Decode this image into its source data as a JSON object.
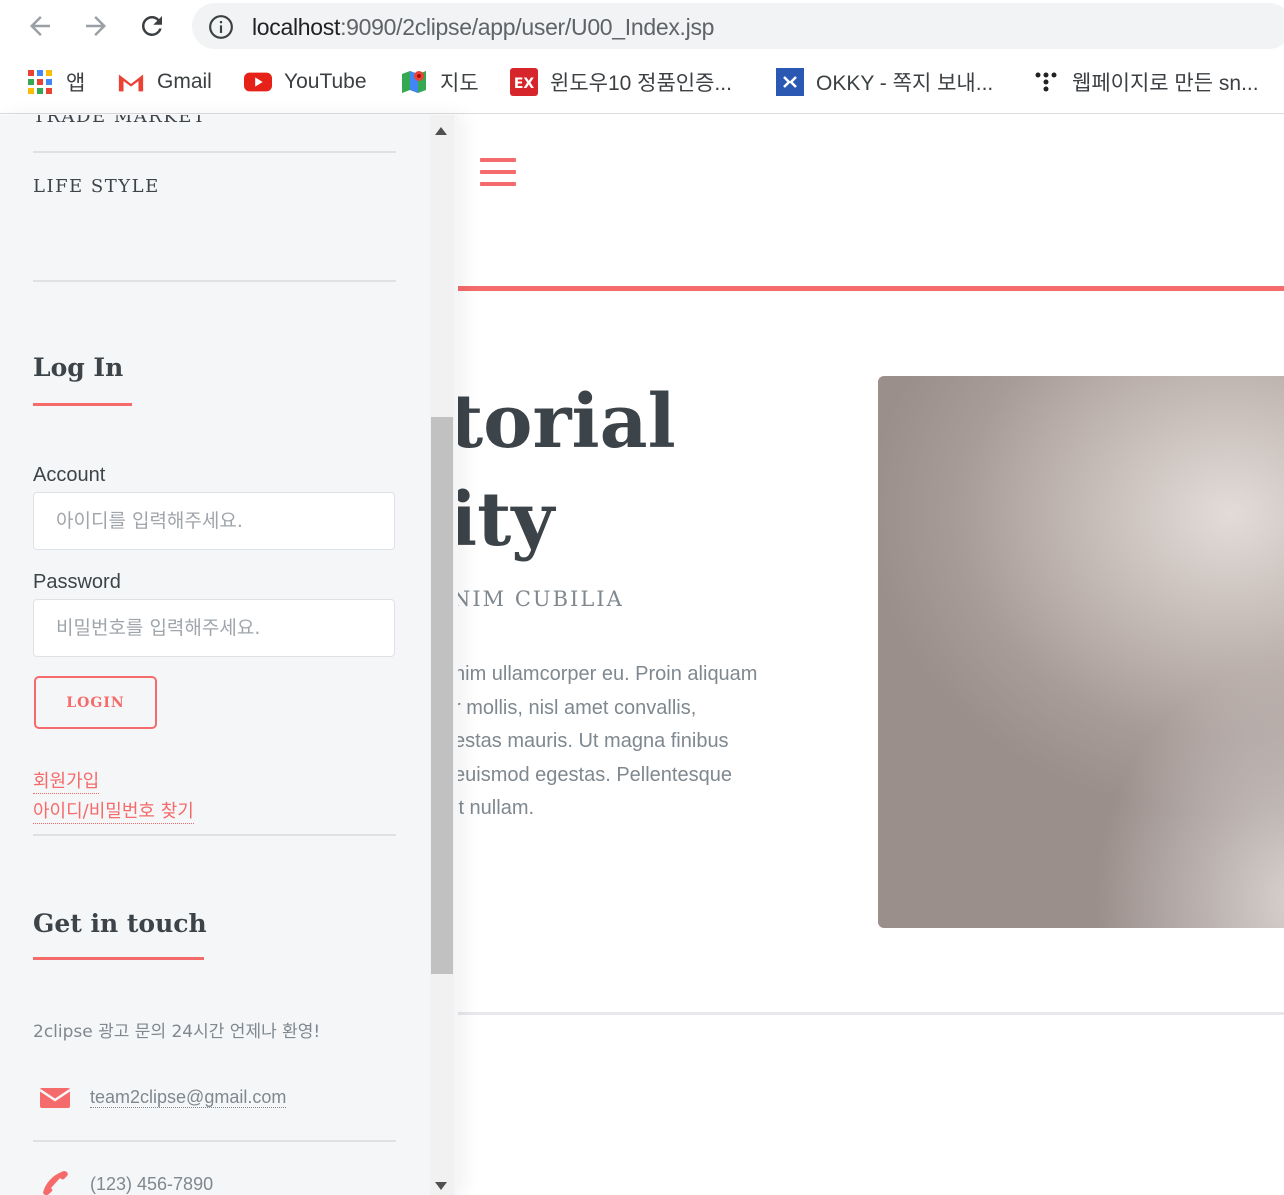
{
  "browser": {
    "url_host": "localhost",
    "url_path": ":9090/2clipse/app/user/U00_Index.jsp",
    "bookmarks": [
      {
        "label": "앱",
        "icon": "apps-grid-icon"
      },
      {
        "label": "Gmail",
        "icon": "gmail-icon"
      },
      {
        "label": "YouTube",
        "icon": "youtube-icon"
      },
      {
        "label": "지도",
        "icon": "maps-icon"
      },
      {
        "label": "윈도우10 정품인증...",
        "icon": "ex-icon"
      },
      {
        "label": "OKKY - 쪽지 보내...",
        "icon": "okky-icon"
      },
      {
        "label": "웹페이지로 만든 sn...",
        "icon": "dots-icon"
      }
    ]
  },
  "sidebar": {
    "menu": {
      "partial_item": "TRADE MARKET",
      "item": "LIFE STYLE"
    },
    "login": {
      "heading": "Log In",
      "account_label": "Account",
      "account_placeholder": "아이디를 입력해주세요.",
      "password_label": "Password",
      "password_placeholder": "비밀번호를 입력해주세요.",
      "login_button": "LOGIN",
      "signup_link": "회원가입",
      "find_link": "아이디/비밀번호 찾기"
    },
    "contact": {
      "heading": "Get in touch",
      "text": "2clipse 광고 문의 24시간 언제나 환영!",
      "email": "team2clipse@gmail.com",
      "phone": "(123) 456-7890"
    }
  },
  "main": {
    "hero_title_line1": "torial",
    "hero_title_line2": "ity",
    "hero_subtitle": "NIM CUBILIA",
    "hero_body": [
      "nim ullamcorper eu. Proin aliquam",
      "r mollis, nisl amet convallis,",
      "estas mauris. Ut magna finibus",
      "euismod egestas. Pellentesque",
      "it nullam."
    ]
  },
  "colors": {
    "accent": "#f56a6a",
    "text": "#3d4449",
    "muted": "#7f888f",
    "sidebar_bg": "#f5f6f7"
  }
}
